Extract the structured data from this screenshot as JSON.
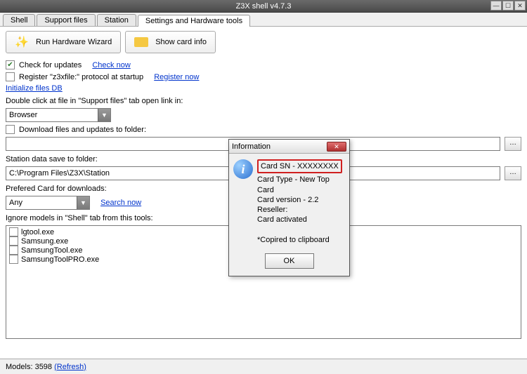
{
  "title": "Z3X shell v4.7.3",
  "tabs": {
    "shell": "Shell",
    "support": "Support files",
    "station": "Station",
    "settings": "Settings and Hardware tools"
  },
  "toolbar": {
    "wizard": "Run Hardware Wizard",
    "cardinfo": "Show card info"
  },
  "checks": {
    "updates_label": "Check for updates",
    "updates_link": "Check now",
    "register_label": "Register \"z3xfile:\" protocol at startup",
    "register_link": "Register now",
    "init_link": "Initialize files DB",
    "dblclick_label": "Double click at file in \"Support files\" tab open link in:",
    "browser": "Browser",
    "download_label": "Download files and updates to folder:",
    "download_path": "",
    "station_label": "Station data save to folder:",
    "station_path": "C:\\Program Files\\Z3X\\Station",
    "preferred_label": "Prefered Card for downloads:",
    "preferred_value": "Any",
    "search_link": "Search now",
    "ignore_label": "Ignore models in \"Shell\" tab from this tools:"
  },
  "ignore_list": [
    "lgtool.exe",
    "Samsung.exe",
    "SamsungTool.exe",
    "SamsungToolPRO.exe"
  ],
  "status": {
    "models_label": "Models: 3598",
    "refresh": "(Refresh)"
  },
  "dialog": {
    "title": "Information",
    "sn": "Card SN - XXXXXXXX",
    "type": "Card Type - New Top Card",
    "version": "Card version - 2.2",
    "reseller": "Reseller:",
    "activated": "Card activated",
    "copied": "*Copired to clipboard",
    "ok": "OK"
  }
}
